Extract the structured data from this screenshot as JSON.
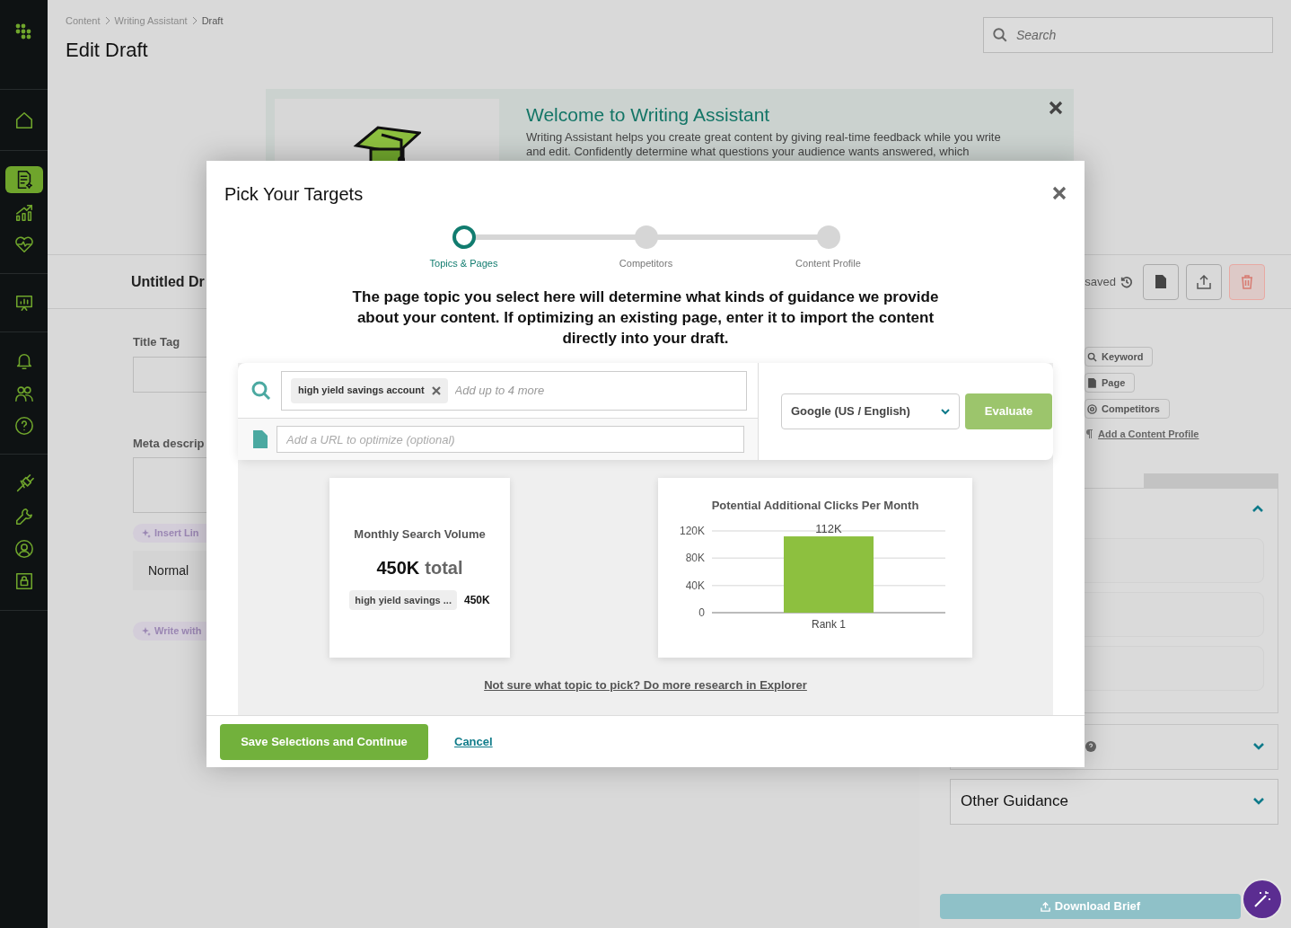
{
  "sidebar": {
    "groups": [
      {
        "items": [
          {
            "kind": "home",
            "selected": false
          }
        ]
      },
      {
        "items": [
          {
            "kind": "document",
            "selected": true
          },
          {
            "kind": "growth",
            "selected": false
          },
          {
            "kind": "health",
            "selected": false
          }
        ]
      },
      {
        "items": [
          {
            "kind": "presentation",
            "selected": false
          }
        ]
      },
      {
        "items": [
          {
            "kind": "bell",
            "selected": false
          },
          {
            "kind": "people",
            "selected": false
          },
          {
            "kind": "help",
            "selected": false
          }
        ]
      },
      {
        "items": [
          {
            "kind": "plug",
            "selected": false
          },
          {
            "kind": "wrench",
            "selected": false
          },
          {
            "kind": "user",
            "selected": false
          },
          {
            "kind": "lock",
            "selected": false
          }
        ]
      }
    ]
  },
  "header": {
    "breadcrumb": [
      "Content",
      "Writing Assistant",
      "Draft"
    ],
    "title": "Edit Draft",
    "search": {
      "placeholder": "Search"
    }
  },
  "banner": {
    "title": "Welcome to Writing Assistant",
    "lines": [
      "Writing Assistant helps you create great content by giving real-time feedback while you write",
      "and edit. Confidently determine what questions your audience wants answered, which"
    ]
  },
  "toolbar": {
    "draft_title": "Untitled Dr",
    "save_status": "saved"
  },
  "form": {
    "title_tag_label": "Title Tag",
    "meta_label": "Meta descrip",
    "insert_button": "Insert Lin",
    "format_select": "Normal",
    "write_button": "Write with"
  },
  "right_panel": {
    "tags": [
      {
        "kind": "search",
        "label": "Keyword"
      },
      {
        "kind": "page",
        "label": "Page"
      },
      {
        "kind": "target",
        "label": "Competitors"
      }
    ],
    "profile_link": "Add a Content Profile",
    "sections": [
      {
        "kind": "cards",
        "expanded": true
      },
      {
        "kind": "help",
        "expanded": false
      },
      {
        "kind": "titled",
        "title": "Other Guidance",
        "expanded": false
      }
    ],
    "download_button": "Download Brief"
  },
  "modal": {
    "title": "Pick Your Targets",
    "steps": [
      {
        "label": "Topics & Pages",
        "selected": true
      },
      {
        "label": "Competitors",
        "selected": false
      },
      {
        "label": "Content Profile",
        "selected": false
      }
    ],
    "intro": "The page topic you select here will determine what kinds of guidance we provide about your content. If optimizing an existing page, enter it to import the content directly into your draft.",
    "keywords": [
      {
        "text": "high yield savings account"
      }
    ],
    "keyword_placeholder": "Add up to 4 more",
    "url_placeholder": "Add a URL to optimize (optional)",
    "engine_select": "Google (US / English)",
    "evaluate_button": {
      "label": "Evaluate",
      "disabled": true
    },
    "volume_card": {
      "title": "Monthly Search Volume",
      "total_value": "450K",
      "total_word": "total",
      "rows": [
        {
          "keyword": "high yield savings ...",
          "value": "450K"
        }
      ]
    },
    "clicks_card": {
      "chart_data": {
        "type": "bar",
        "title": "Potential Additional Clicks Per Month",
        "categories": [
          "Rank 1"
        ],
        "series": [
          {
            "color": "#8dc03f",
            "values": [
              112000
            ]
          }
        ],
        "ylim": [
          0,
          120000
        ],
        "yticks": [
          {
            "value": 0,
            "label": "0"
          },
          {
            "value": 40000,
            "label": "40K"
          },
          {
            "value": 80000,
            "label": "80K"
          },
          {
            "value": 120000,
            "label": "120K"
          }
        ],
        "value_labels": [
          "112K"
        ]
      }
    },
    "research_link": "Not sure what topic to pick? Do more research in Explorer",
    "save_button": "Save Selections and Continue",
    "cancel_link": "Cancel"
  }
}
